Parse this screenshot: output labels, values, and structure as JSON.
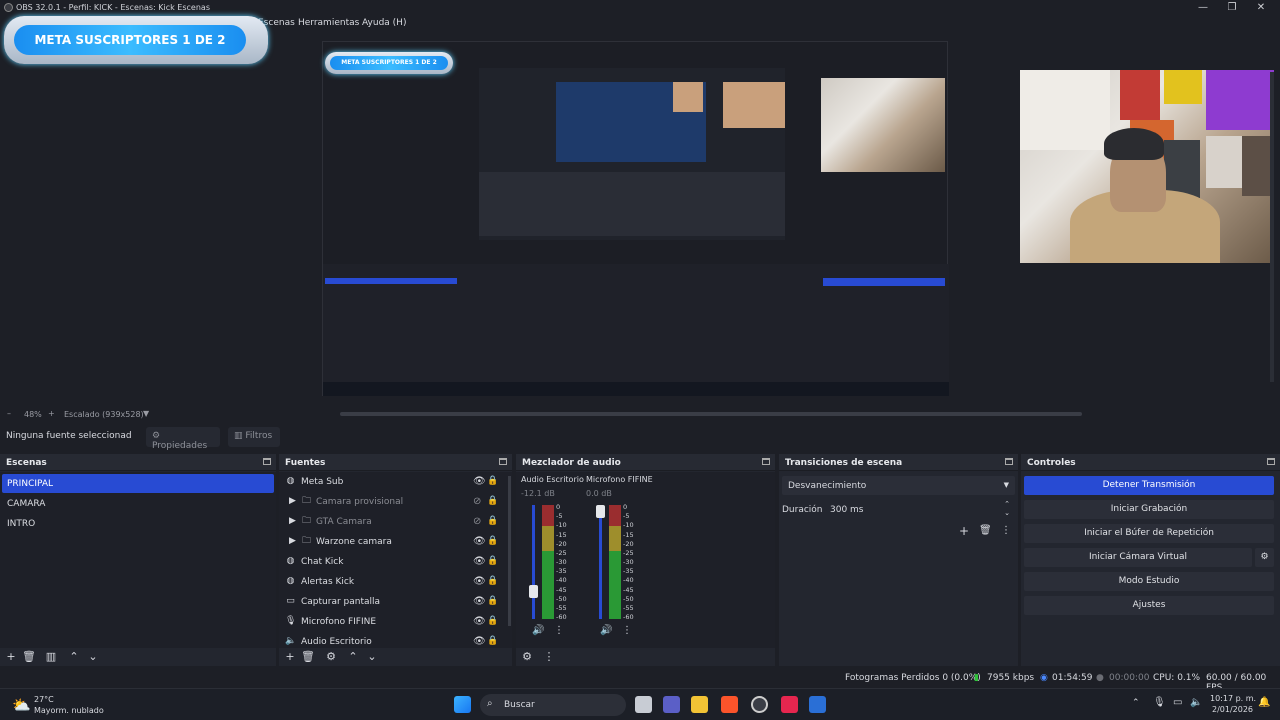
{
  "window": {
    "title": "OBS 32.0.1 - Perfil: KICK - Escenas: Kick Escenas",
    "controls": [
      "—",
      "❐",
      "✕"
    ]
  },
  "menu": {
    "items": [
      "Escenas",
      "Herramientas",
      "Ayuda (H)"
    ]
  },
  "overlay": {
    "goal_text": "META SUSCRIPTORES 1 DE 2"
  },
  "preview_footer": {
    "zoom": "48%",
    "scale": "Escalado (939x528)",
    "minus": "–",
    "plus": "+"
  },
  "source_toolbar": {
    "no_selection": "Ninguna fuente seleccionad",
    "properties": "Propiedades",
    "filters": "Filtros"
  },
  "scenes": {
    "title": "Escenas",
    "items": [
      "PRINCIPAL",
      "CAMARA",
      "INTRO"
    ],
    "selected": "PRINCIPAL"
  },
  "sources": {
    "title": "Fuentes",
    "items": [
      {
        "label": "Meta Sub",
        "icon": "browser-icon",
        "visible": true
      },
      {
        "label": "Camara provisional",
        "icon": "folder-icon",
        "visible": false,
        "group": true
      },
      {
        "label": "GTA Camara",
        "icon": "folder-icon",
        "visible": false,
        "group": true
      },
      {
        "label": "Warzone camara",
        "icon": "folder-icon",
        "visible": true,
        "group": true
      },
      {
        "label": "Chat Kick",
        "icon": "browser-icon",
        "visible": true
      },
      {
        "label": "Alertas Kick",
        "icon": "browser-icon",
        "visible": true
      },
      {
        "label": "Capturar pantalla",
        "icon": "monitor-icon",
        "visible": true
      },
      {
        "label": "Microfono FIFINE",
        "icon": "microphone-icon",
        "visible": true
      },
      {
        "label": "Audio Escritorio",
        "icon": "speaker-icon",
        "visible": true
      }
    ]
  },
  "mixer": {
    "title": "Mezclador de audio",
    "channels": [
      {
        "name": "Audio Escritorio",
        "level": "-12.1 dB",
        "fader": 0.2
      },
      {
        "name": "Microfono FIFINE",
        "level": "0.0 dB",
        "fader": 1.0
      }
    ],
    "scale": [
      "0",
      "-5",
      "-10",
      "-15",
      "-20",
      "-25",
      "-30",
      "-35",
      "-40",
      "-45",
      "-50",
      "-55",
      "-60"
    ]
  },
  "transitions": {
    "title": "Transiciones de escena",
    "selected": "Desvanecimiento",
    "duration_label": "Duración",
    "duration_value": "300 ms"
  },
  "controls": {
    "title": "Controles",
    "buttons": [
      "Detener Transmisión",
      "Iniciar Grabación",
      "Iniciar el Búfer de Repetición",
      "Iniciar Cámara Virtual",
      "Modo Estudio",
      "Ajustes"
    ]
  },
  "status": {
    "dropped": "Fotogramas Perdidos 0 (0.0%)",
    "bitrate": "7955 kbps",
    "stream_time": "01:54:59",
    "rec_time": "00:00:00",
    "cpu": "CPU: 0.1%",
    "fps": "60.00 / 60.00 FPS"
  },
  "taskbar": {
    "weather_temp": "27°C",
    "weather_desc": "Mayorm. nublado",
    "search": "Buscar",
    "time": "10:17 p. m.",
    "date": "2/01/2026"
  },
  "colors": {
    "accent": "#284bd3",
    "bg": "#1d1f26",
    "dock": "#23262f",
    "meter_green": "#2fc13a",
    "meter_yellow": "#c9b32e",
    "meter_red": "#c43232"
  }
}
